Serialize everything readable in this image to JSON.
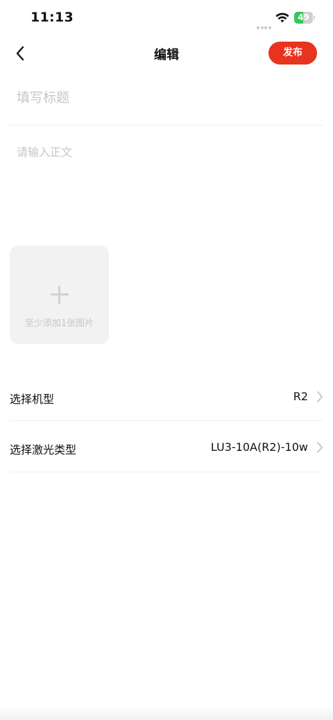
{
  "status_bar": {
    "time": "11:13",
    "battery_level": "49",
    "battery_fraction": 0.49,
    "battery_color": "#34c759",
    "icons": [
      "signal-icon",
      "wifi-icon",
      "battery-icon"
    ]
  },
  "nav": {
    "back_icon": "chevron-left-icon",
    "title": "编辑",
    "publish_label": "发布",
    "publish_color": "#e8331f"
  },
  "editor": {
    "title_placeholder": "填写标题",
    "title_value": "",
    "body_placeholder": "请输入正文",
    "body_value": ""
  },
  "image_upload": {
    "icon": "plus-icon",
    "hint": "至少添加1张图片"
  },
  "options": [
    {
      "label": "选择机型",
      "value": "R2",
      "icon": "chevron-right-icon"
    },
    {
      "label": "选择激光类型",
      "value": "LU3-10A(R2)-10w",
      "icon": "chevron-right-icon"
    }
  ]
}
